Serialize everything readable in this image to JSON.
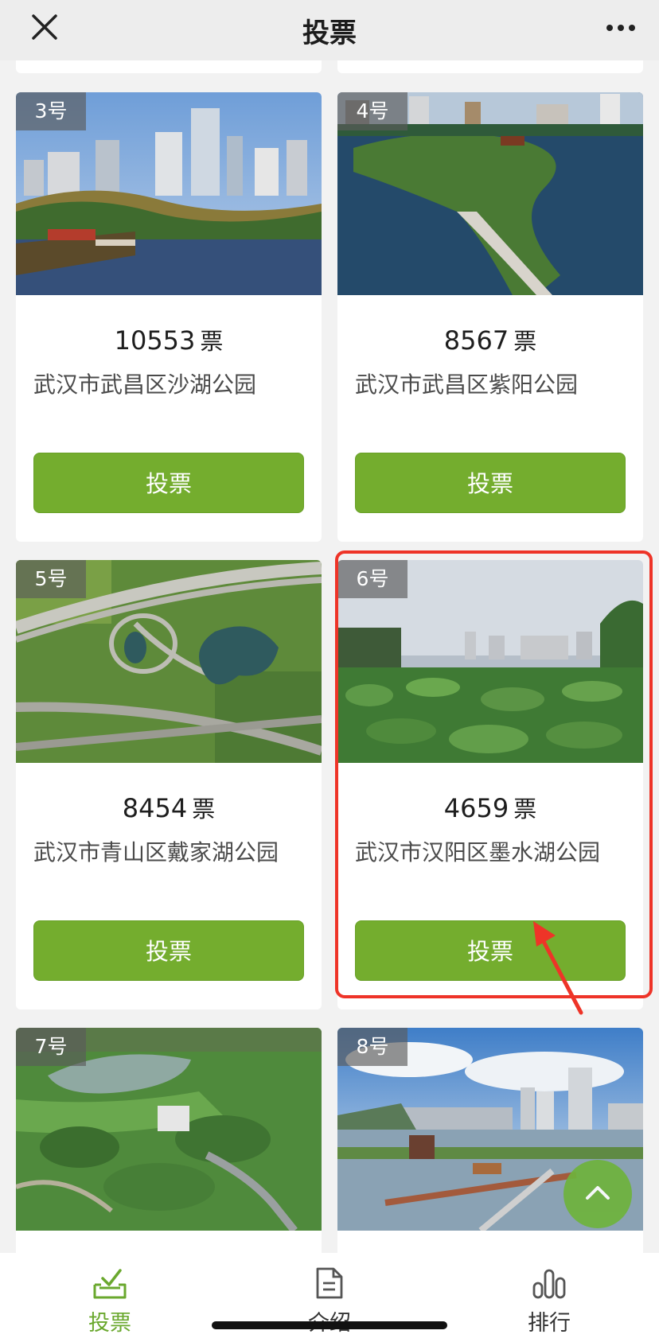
{
  "header": {
    "title": "投票"
  },
  "cards": [
    {
      "badge": "3号",
      "votes": "10553",
      "unit": "票",
      "name": "武汉市武昌区沙湖公园",
      "button": "投票"
    },
    {
      "badge": "4号",
      "votes": "8567",
      "unit": "票",
      "name": "武汉市武昌区紫阳公园",
      "button": "投票"
    },
    {
      "badge": "5号",
      "votes": "8454",
      "unit": "票",
      "name": "武汉市青山区戴家湖公园",
      "button": "投票"
    },
    {
      "badge": "6号",
      "votes": "4659",
      "unit": "票",
      "name": "武汉市汉阳区墨水湖公园",
      "button": "投票"
    },
    {
      "badge": "7号"
    },
    {
      "badge": "8号"
    }
  ],
  "tabs": [
    {
      "label": "投票",
      "icon": "vote-box-icon",
      "active": true
    },
    {
      "label": "介绍",
      "icon": "document-icon"
    },
    {
      "label": "排行",
      "icon": "bar-chart-icon"
    }
  ],
  "colors": {
    "accent": "#74ad2e",
    "highlight": "#ee3428",
    "active_tab": "#6aa82e"
  }
}
